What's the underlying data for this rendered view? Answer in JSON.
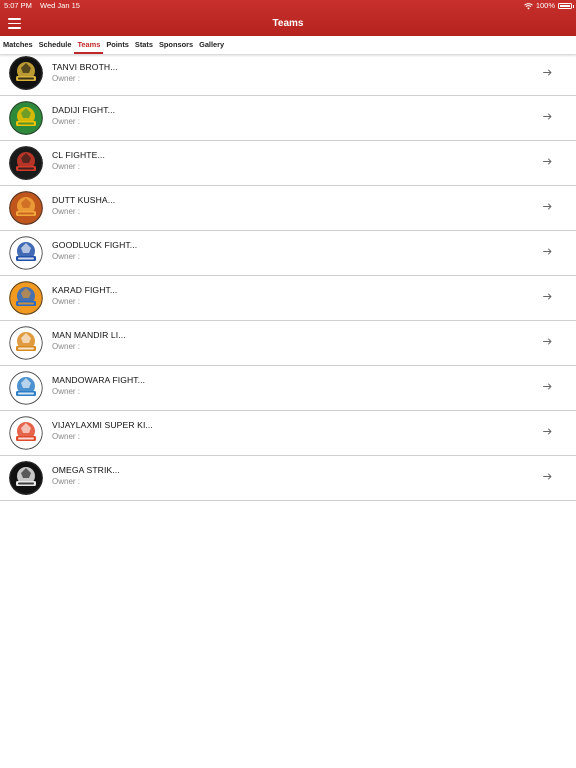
{
  "status_bar": {
    "time": "5:07 PM",
    "date": "Wed Jan 15",
    "battery": "100%"
  },
  "header": {
    "title": "Teams"
  },
  "tabs": [
    {
      "label": "Matches",
      "active": false
    },
    {
      "label": "Schedule",
      "active": false
    },
    {
      "label": "Teams",
      "active": true
    },
    {
      "label": "Points",
      "active": false
    },
    {
      "label": "Stats",
      "active": false
    },
    {
      "label": "Sponsors",
      "active": false
    },
    {
      "label": "Gallery",
      "active": false
    }
  ],
  "colors": {
    "header": "#c0292a",
    "active_tab": "#c0292a",
    "owner_text": "#888888",
    "divider": "#cfcfcf"
  },
  "teams": [
    {
      "name": "TANVI BROTH...",
      "owner": "Owner :",
      "logo_icon": "tanvi-brothers-logo",
      "logo_colors": [
        "#111111",
        "#d9b23a"
      ]
    },
    {
      "name": "DADIJI FIGHT...",
      "owner": "Owner :",
      "logo_icon": "dadiji-fighters-logo",
      "logo_colors": [
        "#2c8a3a",
        "#f2c200"
      ]
    },
    {
      "name": "CL FIGHTE...",
      "owner": "Owner :",
      "logo_icon": "cl-fighters-logo",
      "logo_colors": [
        "#1a1a1a",
        "#d43b2a"
      ]
    },
    {
      "name": "DUTT KUSHA...",
      "owner": "Owner :",
      "logo_icon": "dutt-kushal-logo",
      "logo_colors": [
        "#c0561c",
        "#f1a53a"
      ]
    },
    {
      "name": "GOODLUCK FIGHT...",
      "owner": "Owner :",
      "logo_icon": "goodluck-fighters-logo",
      "logo_colors": [
        "#ffffff",
        "#2050a8"
      ]
    },
    {
      "name": "KARAD FIGHT...",
      "owner": "Owner :",
      "logo_icon": "karad-fighters-logo",
      "logo_colors": [
        "#f29a1f",
        "#2a6ac8"
      ]
    },
    {
      "name": "MAN MANDIR LI...",
      "owner": "Owner :",
      "logo_icon": "man-mandir-logo",
      "logo_colors": [
        "#ffffff",
        "#d9891e"
      ]
    },
    {
      "name": "MANDOWARA FIGHT...",
      "owner": "Owner :",
      "logo_icon": "mandowara-fighters-logo",
      "logo_colors": [
        "#ffffff",
        "#2d7ec8"
      ]
    },
    {
      "name": "VIJAYLAXMI SUPER KI...",
      "owner": "Owner :",
      "logo_icon": "vijaylaxmi-super-kings-logo",
      "logo_colors": [
        "#ffffff",
        "#e0492a"
      ]
    },
    {
      "name": "OMEGA STRIK...",
      "owner": "Owner :",
      "logo_icon": "omega-strikers-logo",
      "logo_colors": [
        "#111111",
        "#e8e8e8"
      ]
    }
  ]
}
